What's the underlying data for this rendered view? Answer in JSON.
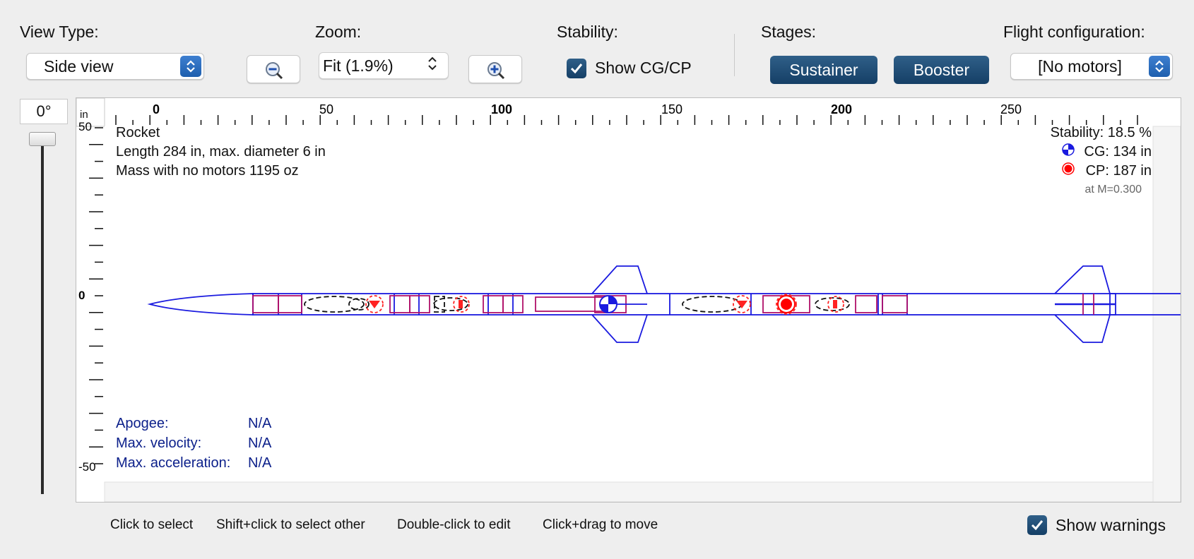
{
  "toolbar": {
    "view_type_label": "View Type:",
    "view_type_value": "Side view",
    "zoom_label": "Zoom:",
    "zoom_value": "Fit (1.9%)",
    "stability_label": "Stability:",
    "show_cgcp_label": "Show CG/CP",
    "show_cgcp_checked": true,
    "stages_label": "Stages:",
    "stages": [
      "Sustainer",
      "Booster"
    ],
    "flight_config_label": "Flight configuration:",
    "flight_config_value": "[No motors]"
  },
  "rotation": {
    "angle": "0°"
  },
  "ruler": {
    "unit": "in",
    "top_labels": [
      "0",
      "50",
      "100",
      "150",
      "200",
      "250"
    ],
    "left_labels": [
      "50",
      "0",
      "-50"
    ]
  },
  "rocket_info": {
    "name": "Rocket",
    "length_line": "Length 284 in, max. diameter 6 in",
    "mass_line": "Mass with no motors 1195 oz"
  },
  "stability_info": {
    "stability": "Stability: 18.5 %",
    "cg": "CG: 134 in",
    "cp": "CP: 187 in",
    "mach": "at M=0.300"
  },
  "flight_data": {
    "apogee_label": "Apogee:",
    "apogee_value": "N/A",
    "max_velocity_label": "Max. velocity:",
    "max_velocity_value": "N/A",
    "max_acceleration_label": "Max. acceleration:",
    "max_acceleration_value": "N/A"
  },
  "hints": {
    "click_select": "Click to select",
    "shift_click": "Shift+click to select other",
    "double_click": "Double-click to edit",
    "click_drag": "Click+drag to move"
  },
  "warnings": {
    "label": "Show warnings",
    "checked": true
  },
  "colors": {
    "accent": "#1e5fae",
    "stage_button": "#1f4c76",
    "rocket_outline": "#1a1adf",
    "inner_component": "#b0106a",
    "cp_marker": "#ff0000",
    "flight_text": "#0b1f8a"
  }
}
